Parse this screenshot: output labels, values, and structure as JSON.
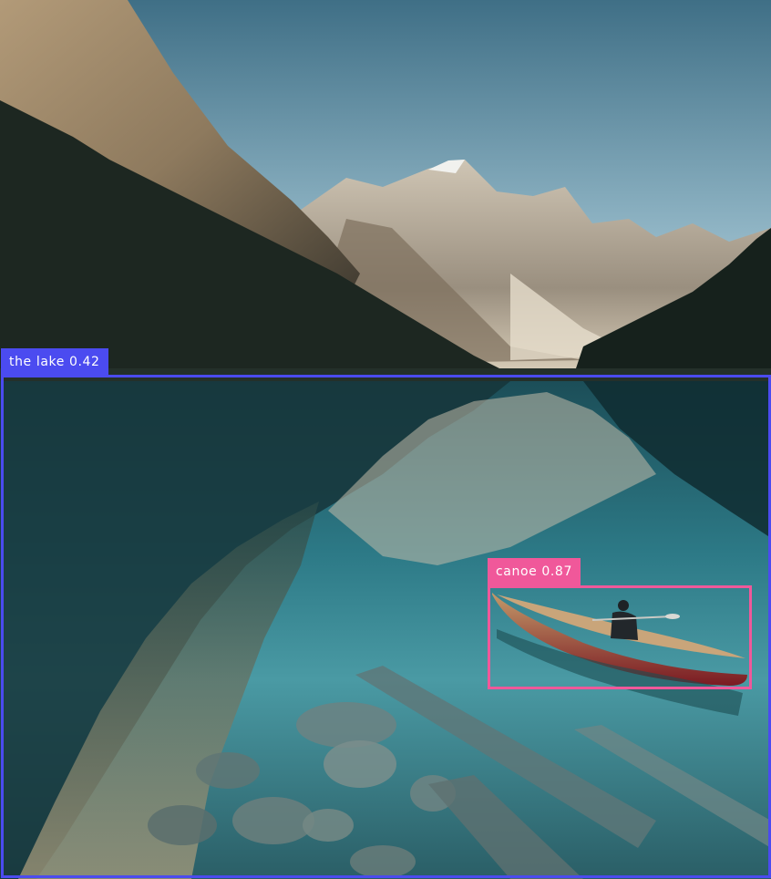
{
  "image": {
    "description_tag": "mountain-lake-photo"
  },
  "detections": [
    {
      "label": "the lake",
      "score": "0.42",
      "color": "#4b4bf0"
    },
    {
      "label": "canoe",
      "score": "0.87",
      "color": "#f0589a"
    }
  ],
  "labels": {
    "lake": "the lake 0.42",
    "canoe": "canoe 0.87"
  }
}
